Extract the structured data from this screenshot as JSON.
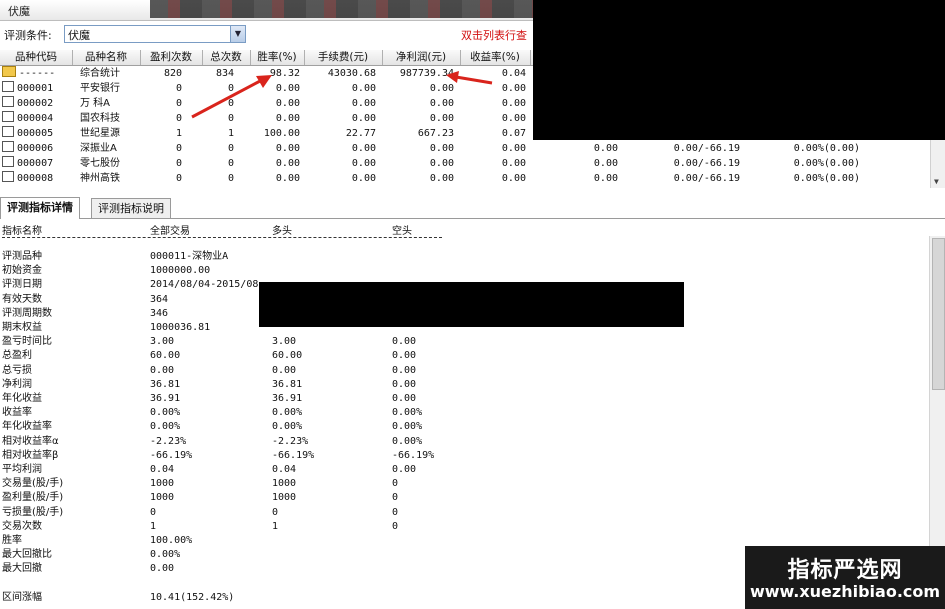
{
  "window": {
    "title": "伏魔"
  },
  "filter": {
    "label": "评测条件:",
    "value": "伏魔",
    "hint": "双击列表行查"
  },
  "grid": {
    "columns": [
      "品种代码",
      "品种名称",
      "盈利次数",
      "总次数",
      "胜率(%)",
      "手续费(元)",
      "净利润(元)",
      "收益率(%)"
    ],
    "rows": [
      {
        "code": "------",
        "name": "综合统计",
        "win": "820",
        "total": "834",
        "rate": "98.32",
        "fee": "43030.68",
        "profit": "987739.34",
        "ret": "0.04",
        "c9": "",
        "c10": "",
        "c11": "",
        "folder": true
      },
      {
        "code": "000001",
        "name": "平安银行",
        "win": "0",
        "total": "0",
        "rate": "0.00",
        "fee": "0.00",
        "profit": "0.00",
        "ret": "0.00",
        "c9": "",
        "c10": "",
        "c11": ""
      },
      {
        "code": "000002",
        "name": "万  科A",
        "win": "0",
        "total": "0",
        "rate": "0.00",
        "fee": "0.00",
        "profit": "0.00",
        "ret": "0.00",
        "c9": "",
        "c10": "",
        "c11": ""
      },
      {
        "code": "000004",
        "name": "国农科技",
        "win": "0",
        "total": "0",
        "rate": "0.00",
        "fee": "0.00",
        "profit": "0.00",
        "ret": "0.00",
        "c9": "",
        "c10": "",
        "c11": ""
      },
      {
        "code": "000005",
        "name": "世纪星源",
        "win": "1",
        "total": "1",
        "rate": "100.00",
        "fee": "22.77",
        "profit": "667.23",
        "ret": "0.07",
        "c9": "",
        "c10": "",
        "c11": ""
      },
      {
        "code": "000006",
        "name": "深振业A",
        "win": "0",
        "total": "0",
        "rate": "0.00",
        "fee": "0.00",
        "profit": "0.00",
        "ret": "0.00",
        "c9": "0.00",
        "c10": "0.00/-66.19",
        "c11": "0.00%(0.00)"
      },
      {
        "code": "000007",
        "name": "零七股份",
        "win": "0",
        "total": "0",
        "rate": "0.00",
        "fee": "0.00",
        "profit": "0.00",
        "ret": "0.00",
        "c9": "0.00",
        "c10": "0.00/-66.19",
        "c11": "0.00%(0.00)"
      },
      {
        "code": "000008",
        "name": "神州高铁",
        "win": "0",
        "total": "0",
        "rate": "0.00",
        "fee": "0.00",
        "profit": "0.00",
        "ret": "0.00",
        "c9": "0.00",
        "c10": "0.00/-66.19",
        "c11": "0.00%(0.00)"
      }
    ]
  },
  "tabs": [
    "评测指标详情",
    "评测指标说明"
  ],
  "detail": {
    "columns": [
      "指标名称",
      "全部交易",
      "多头",
      "空头"
    ],
    "rows": [
      {
        "name": "评测品种",
        "all": "000011-深物业A",
        "long": "",
        "short": ""
      },
      {
        "name": "初始资金",
        "all": "1000000.00",
        "long": "",
        "short": ""
      },
      {
        "name": "评测日期",
        "all": "2014/08/04-2015/08",
        "long": "",
        "short": ""
      },
      {
        "name": "有效天数",
        "all": "364",
        "long": "",
        "short": ""
      },
      {
        "name": "评测周期数",
        "all": "346",
        "long": "",
        "short": ""
      },
      {
        "name": "期末权益",
        "all": "1000036.81",
        "long": "",
        "short": ""
      },
      {
        "name": "盈亏时间比",
        "all": "3.00",
        "long": "3.00",
        "short": "0.00"
      },
      {
        "name": "总盈利",
        "all": "60.00",
        "long": "60.00",
        "short": "0.00"
      },
      {
        "name": "总亏损",
        "all": "0.00",
        "long": "0.00",
        "short": "0.00"
      },
      {
        "name": "净利润",
        "all": "36.81",
        "long": "36.81",
        "short": "0.00"
      },
      {
        "name": "年化收益",
        "all": "36.91",
        "long": "36.91",
        "short": "0.00"
      },
      {
        "name": "收益率",
        "all": "0.00%",
        "long": "0.00%",
        "short": "0.00%"
      },
      {
        "name": "年化收益率",
        "all": "0.00%",
        "long": "0.00%",
        "short": "0.00%"
      },
      {
        "name": "相对收益率α",
        "all": "-2.23%",
        "long": "-2.23%",
        "short": "0.00%"
      },
      {
        "name": "相对收益率β",
        "all": "-66.19%",
        "long": "-66.19%",
        "short": "-66.19%"
      },
      {
        "name": "平均利润",
        "all": "0.04",
        "long": "0.04",
        "short": "0.00"
      },
      {
        "name": "交易量(股/手)",
        "all": "1000",
        "long": "1000",
        "short": "0"
      },
      {
        "name": "盈利量(股/手)",
        "all": "1000",
        "long": "1000",
        "short": "0"
      },
      {
        "name": "亏损量(股/手)",
        "all": "0",
        "long": "0",
        "short": "0"
      },
      {
        "name": "交易次数",
        "all": "1",
        "long": "1",
        "short": "0"
      },
      {
        "name": "胜率",
        "all": "100.00%",
        "long": "",
        "short": ""
      },
      {
        "name": "最大回撤比",
        "all": "0.00%",
        "long": "",
        "short": ""
      },
      {
        "name": "最大回撤",
        "all": "0.00",
        "long": "",
        "short": ""
      },
      {
        "name": "",
        "all": "",
        "long": "",
        "short": ""
      },
      {
        "name": "区间涨幅",
        "all": "10.41(152.42%)",
        "long": "",
        "short": ""
      }
    ]
  },
  "watermark": {
    "line1": "指标严选网",
    "line2": "www.xuezhibiao.com"
  },
  "colors": {
    "hint": "#d21010",
    "arrow": "#d9241c"
  }
}
